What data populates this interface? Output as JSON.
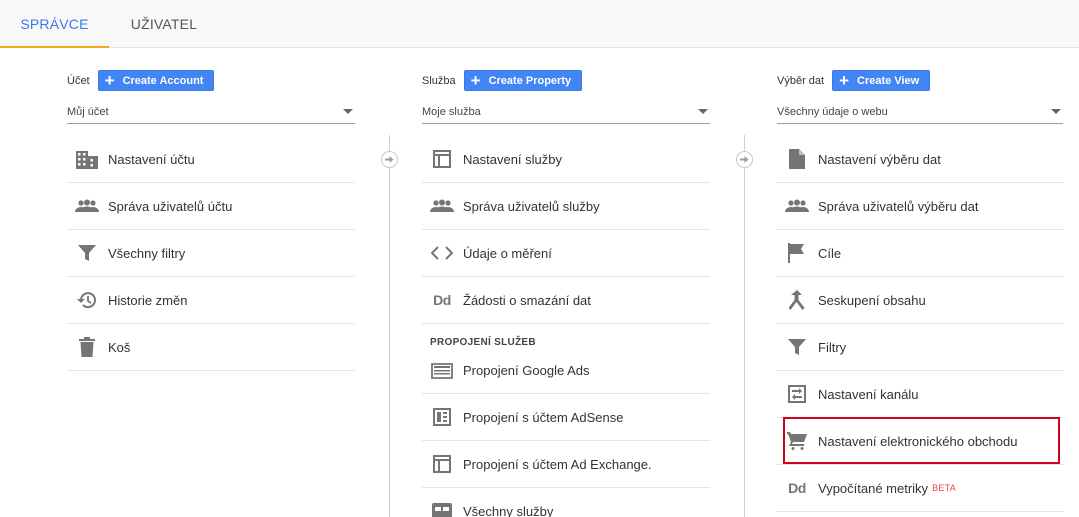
{
  "tabs": [
    {
      "label": "SPRÁVCE",
      "active": true
    },
    {
      "label": "UŽIVATEL",
      "active": false
    }
  ],
  "columns": {
    "account": {
      "label": "Účet",
      "create_label": "Create Account",
      "selected": "Můj účet",
      "items": [
        {
          "label": "Nastavení účtu",
          "icon": "building-icon"
        },
        {
          "label": "Správa uživatelů účtu",
          "icon": "people-icon"
        },
        {
          "label": "Všechny filtry",
          "icon": "filter-icon"
        },
        {
          "label": "Historie změn",
          "icon": "history-icon"
        },
        {
          "label": "Koš",
          "icon": "trash-icon"
        }
      ]
    },
    "property": {
      "label": "Služba",
      "create_label": "Create Property",
      "selected": "Moje služba",
      "items": [
        {
          "label": "Nastavení služby",
          "icon": "layout-icon"
        },
        {
          "label": "Správa uživatelů služby",
          "icon": "people-icon"
        },
        {
          "label": "Údaje o měření",
          "icon": "code-icon"
        },
        {
          "label": "Žádosti o smazání dat",
          "icon": "dd-icon"
        }
      ],
      "section_title": "PROPOJENÍ SLUŽEB",
      "section_items": [
        {
          "label": "Propojení Google Ads",
          "icon": "ads-icon"
        },
        {
          "label": "Propojení s účtem AdSense",
          "icon": "adsense-icon"
        },
        {
          "label": "Propojení s účtem Ad Exchange.",
          "icon": "layout-icon"
        },
        {
          "label": "Všechny služby",
          "icon": "services-icon"
        }
      ]
    },
    "view": {
      "label": "Výběr dat",
      "create_label": "Create View",
      "selected": "Všechny údaje o webu",
      "items": [
        {
          "label": "Nastavení výběru dat",
          "icon": "document-icon"
        },
        {
          "label": "Správa uživatelů výběru dat",
          "icon": "people-icon"
        },
        {
          "label": "Cíle",
          "icon": "flag-icon"
        },
        {
          "label": "Seskupení obsahu",
          "icon": "merge-icon"
        },
        {
          "label": "Filtry",
          "icon": "filter-icon"
        },
        {
          "label": "Nastavení kanálu",
          "icon": "funnel-settings-icon"
        },
        {
          "label": "Nastavení elektronického obchodu",
          "icon": "cart-icon"
        },
        {
          "label": "Vypočítané metriky",
          "icon": "dd-icon",
          "badge": "BETA"
        }
      ]
    }
  },
  "icon_glyphs": {
    "dd": "Dd"
  },
  "colors": {
    "accent": "#4285f4",
    "tab_active": "#3b78e7",
    "tab_underline": "#f5a623",
    "highlight": "#d0021b",
    "icon": "#757575"
  }
}
